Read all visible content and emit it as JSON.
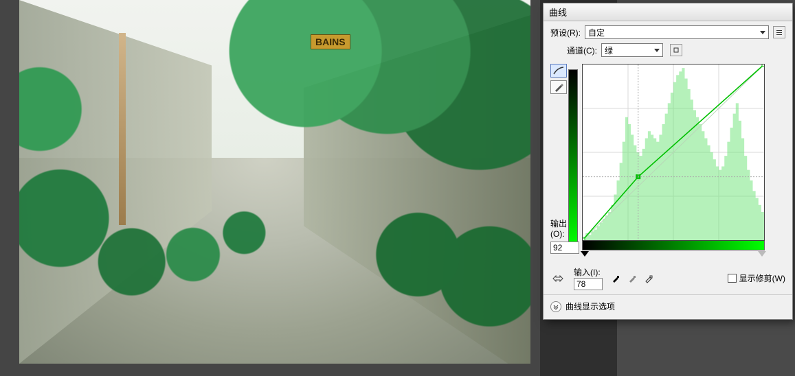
{
  "canvas": {
    "sign_text": "BAINS"
  },
  "dialog": {
    "title": "曲线",
    "preset_label": "预设(R):",
    "preset_value": "自定",
    "channel_label": "通道(C):",
    "channel_value": "绿",
    "output_label": "输出(O):",
    "output_value": "92",
    "input_label": "输入(I):",
    "input_value": "78",
    "show_clipping_label": "显示修剪(W)",
    "display_options_label": "曲线显示选项",
    "channel_color": "#00c000",
    "curve_point": {
      "input": 78,
      "output": 92
    },
    "histogram_heights_pct": [
      2,
      4,
      3,
      5,
      6,
      8,
      10,
      12,
      14,
      16,
      20,
      26,
      34,
      44,
      56,
      70,
      66,
      60,
      54,
      50,
      48,
      52,
      58,
      62,
      60,
      58,
      56,
      60,
      66,
      72,
      78,
      84,
      90,
      94,
      96,
      98,
      92,
      86,
      80,
      74,
      70,
      66,
      62,
      58,
      54,
      50,
      46,
      42,
      40,
      42,
      48,
      56,
      64,
      72,
      78,
      68,
      58,
      48,
      40,
      34,
      28,
      24,
      20,
      16
    ]
  }
}
